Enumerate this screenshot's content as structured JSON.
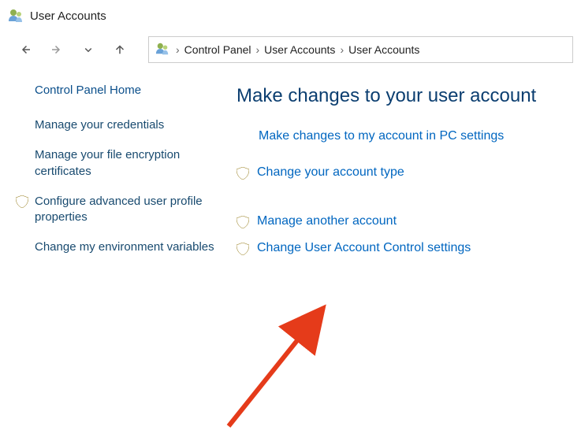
{
  "window": {
    "title": "User Accounts"
  },
  "breadcrumb": {
    "items": [
      "Control Panel",
      "User Accounts",
      "User Accounts"
    ]
  },
  "sidebar": {
    "home": "Control Panel Home",
    "items": [
      {
        "label": "Manage your credentials",
        "shield": false
      },
      {
        "label": "Manage your file encryption certificates",
        "shield": false
      },
      {
        "label": "Configure advanced user profile properties",
        "shield": true
      },
      {
        "label": "Change my environment variables",
        "shield": false
      }
    ]
  },
  "main": {
    "heading": "Make changes to your user account",
    "links": [
      {
        "label": "Make changes to my account in PC settings",
        "shield": false,
        "indent": true
      },
      {
        "label": "Change your account type",
        "shield": true
      },
      {
        "label": "Manage another account",
        "shield": true,
        "gapBefore": true
      },
      {
        "label": "Change User Account Control settings",
        "shield": true
      }
    ]
  }
}
